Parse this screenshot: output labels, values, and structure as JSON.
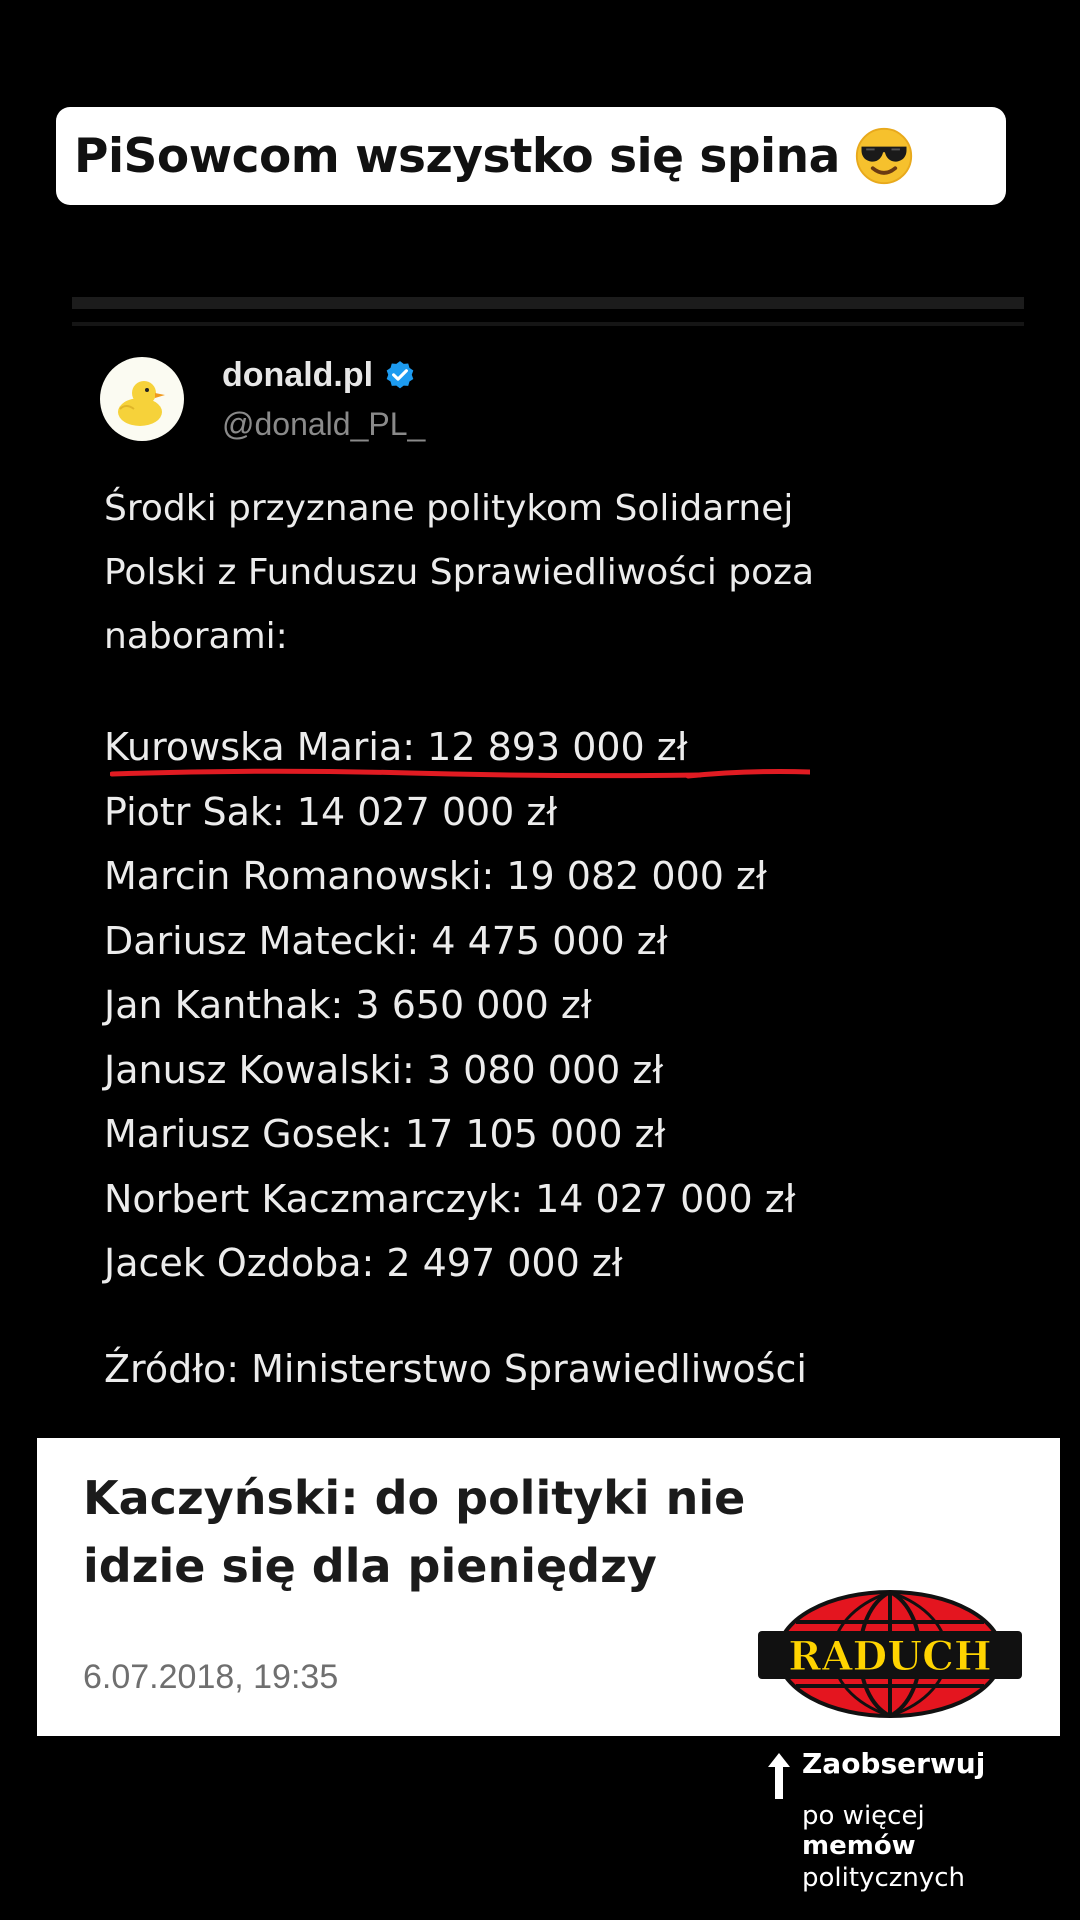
{
  "caption": {
    "text": "PiSowcom wszystko się spina",
    "emoji": "smiling-face-with-sunglasses-icon"
  },
  "tweet": {
    "author": "donald.pl",
    "handle": "@donald_PL_",
    "avatar": "rubber-duck-avatar",
    "verified_color": "#1d9bf0",
    "intro_lines": [
      "Środki przyznane politykom Solidarnej",
      "Polski z Funduszu Sprawiedliwości poza",
      "naborami:"
    ],
    "allocations": [
      "Kurowska Maria: 12 893 000 zł",
      "Piotr Sak: 14 027 000 zł",
      "Marcin Romanowski: 19 082 000 zł",
      "Dariusz Matecki: 4 475 000 zł",
      "Jan Kanthak: 3 650 000 zł",
      "Janusz Kowalski: 3 080 000 zł",
      "Mariusz Gosek: 17 105 000 zł",
      "Norbert Kaczmarczyk: 14 027 000 zł",
      "Jacek Ozdoba: 2 497 000 zł"
    ],
    "underline_color": "#e01b22",
    "source": "Źródło: Ministerstwo Sprawiedliwości"
  },
  "news": {
    "headline": "Kaczyński: do polityki nie idzie się dla pieniędzy",
    "date": "6.07.2018, 19:35",
    "logo_text": "RADUCH",
    "logo_colors": {
      "globe": "#e4151f",
      "text": "#ffd400",
      "outline": "#111111"
    }
  },
  "follow": {
    "title": "Zaobserwuj",
    "line1": "po więcej",
    "line2": "memów",
    "line3": "politycznych"
  }
}
